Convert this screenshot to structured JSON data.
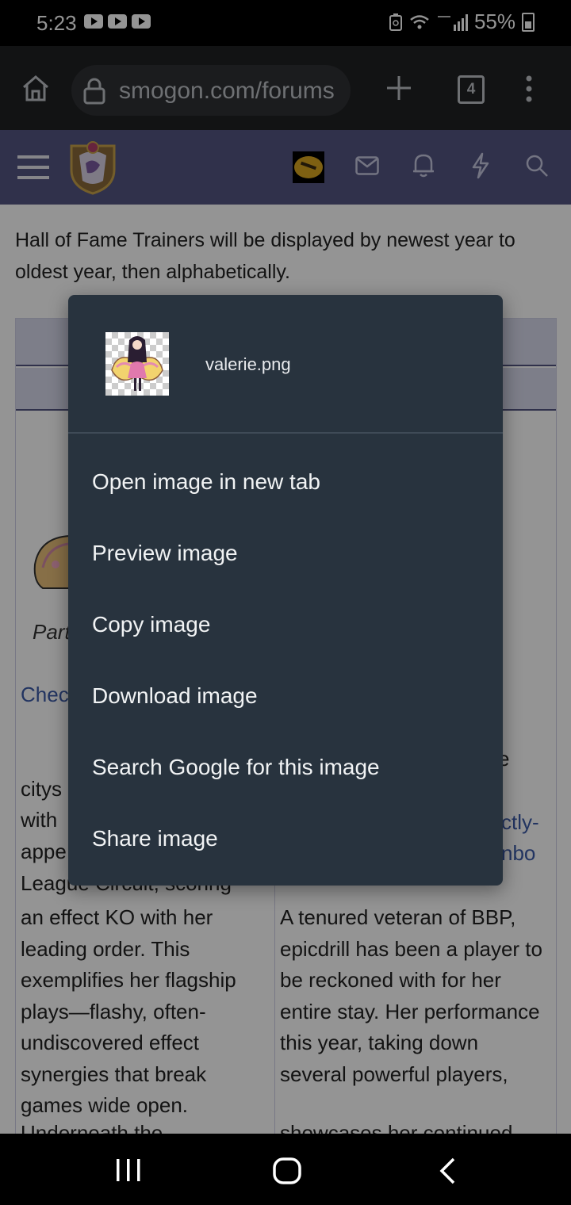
{
  "status_bar": {
    "time": "5:23",
    "battery": "55%",
    "icons": [
      "youtube-icon",
      "youtube-icon",
      "youtube-icon",
      "battery-saver-icon",
      "wifi-icon",
      "signal-icon",
      "battery-icon"
    ]
  },
  "browser": {
    "url": "smogon.com/forums",
    "tab_count": "4"
  },
  "page": {
    "intro": "Hall of Fame Trainers will be displayed by newest year to oldest year, then alphabetically.",
    "left_col_fragments": [
      "Part",
      "Chec",
      "citys",
      "with",
      "appe",
      "League Circuit, scoring"
    ],
    "left_col_body": "an effect KO with her leading order. This exemplifies her flagship plays—flashy, often-undiscovered effect synergies that break games wide open.",
    "left_col_tail": "Underneath the",
    "right_col_fragments": [
      "e",
      "ctly-",
      "nbo"
    ],
    "right_col_body": "A tenured veteran of BBP, epicdrill has been a player to be reckoned with for her entire stay. Her performance this year, taking down several powerful players,",
    "right_col_tail": "showcases her continued"
  },
  "context_menu": {
    "filename": "valerie.png",
    "items": [
      "Open image in new tab",
      "Preview image",
      "Copy image",
      "Download image",
      "Search Google for this image",
      "Share image"
    ]
  }
}
